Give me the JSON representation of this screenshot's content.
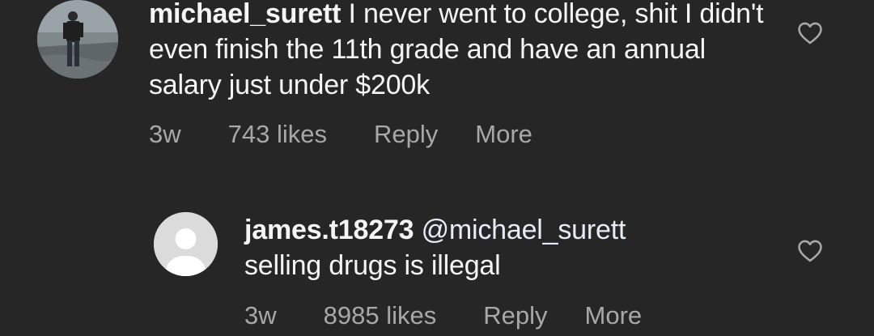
{
  "comments": [
    {
      "username": "michael_surett",
      "text": "I never went to college, shit I didn't even finish the 11th grade and have an annual salary just under $200k",
      "age": "3w",
      "likes": "743 likes",
      "reply_label": "Reply",
      "more_label": "More",
      "like_icon": "heart-outline-icon"
    },
    {
      "username": "james.t18273",
      "mention": "@michael_surett",
      "text": "selling drugs is illegal",
      "age": "3w",
      "likes": "8985 likes",
      "reply_label": "Reply",
      "more_label": "More",
      "like_icon": "heart-outline-icon"
    }
  ],
  "colors": {
    "background": "#262626",
    "primary_text": "#f5f5f5",
    "secondary_text": "#a8a8a8"
  }
}
